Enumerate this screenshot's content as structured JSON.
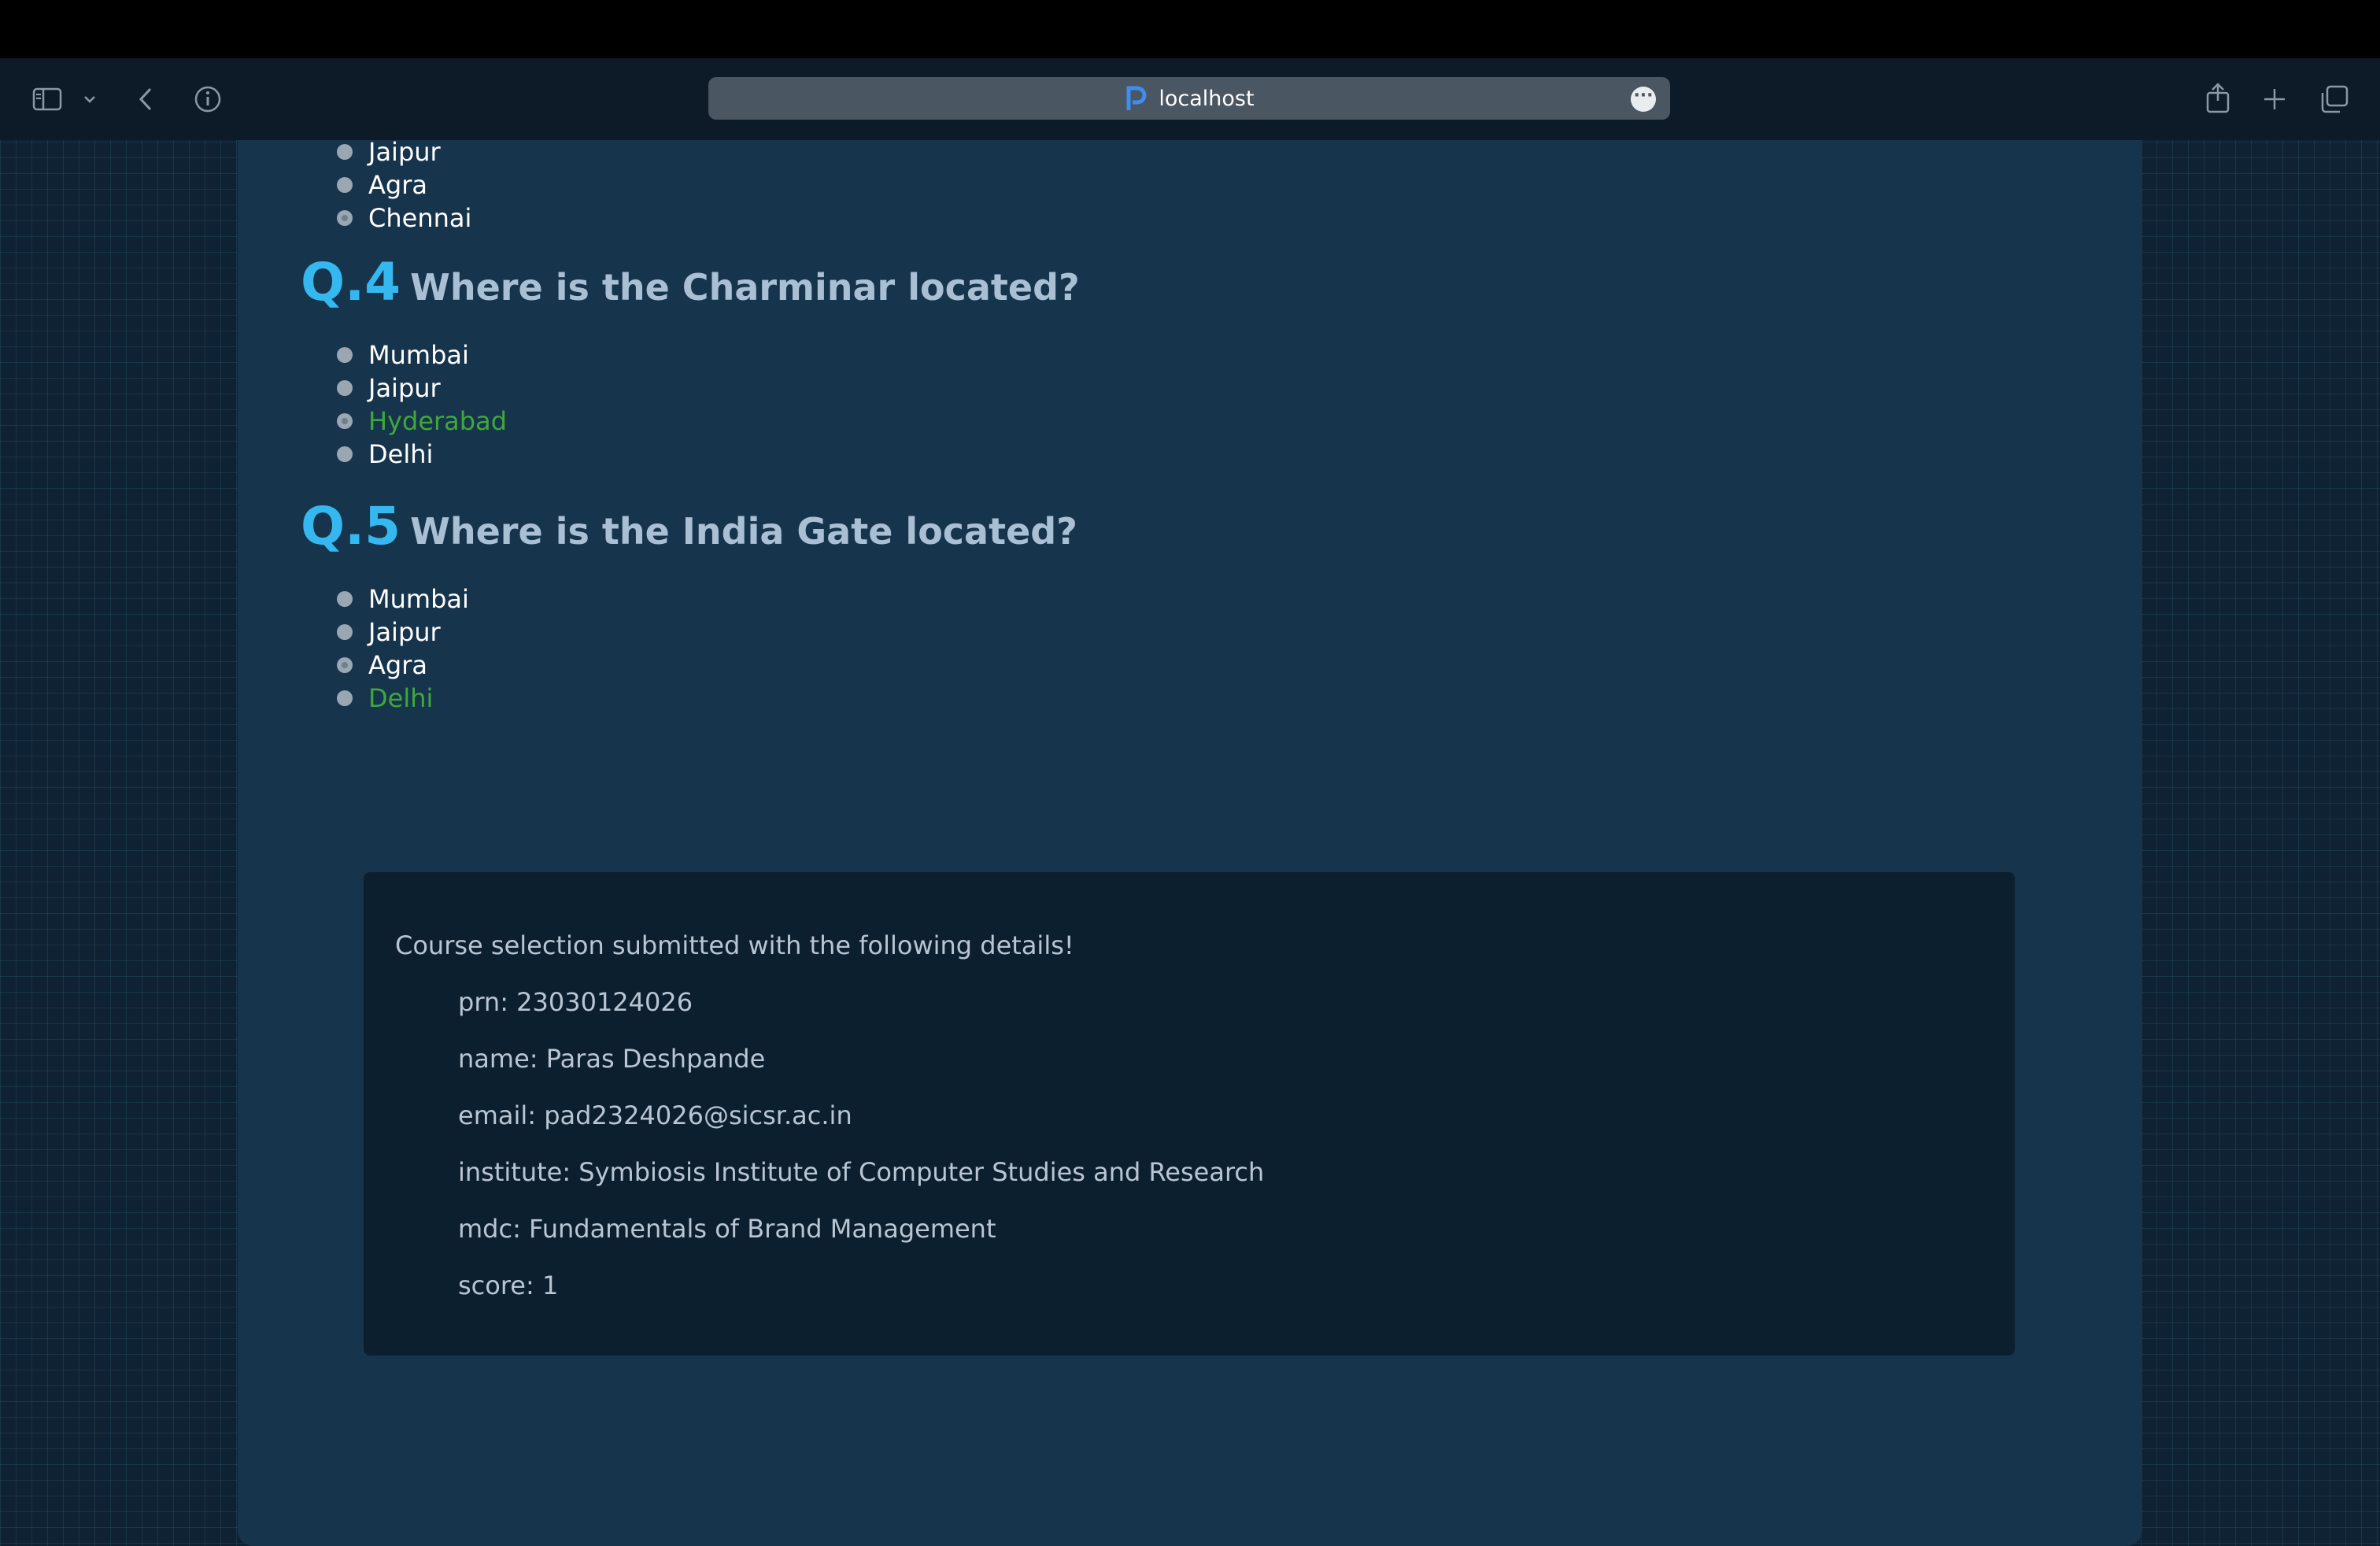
{
  "browser": {
    "url": "localhost"
  },
  "partial_question": {
    "options": [
      {
        "label": "Jaipur",
        "state": "normal"
      },
      {
        "label": "Agra",
        "state": "normal"
      },
      {
        "label": "Chennai",
        "state": "marked"
      }
    ]
  },
  "questions": [
    {
      "number": "Q.4",
      "text": "Where is the Charminar located?",
      "options": [
        {
          "label": "Mumbai",
          "state": "normal"
        },
        {
          "label": "Jaipur",
          "state": "normal"
        },
        {
          "label": "Hyderabad",
          "state": "correct"
        },
        {
          "label": "Delhi",
          "state": "normal"
        }
      ]
    },
    {
      "number": "Q.5",
      "text": "Where is the India Gate located?",
      "options": [
        {
          "label": "Mumbai",
          "state": "normal"
        },
        {
          "label": "Jaipur",
          "state": "normal"
        },
        {
          "label": "Agra",
          "state": "marked"
        },
        {
          "label": "Delhi",
          "state": "correct"
        }
      ]
    }
  ],
  "result": {
    "heading": "Course selection submitted with the following details!",
    "prn": "prn: 23030124026",
    "name": "name: Paras Deshpande",
    "email": "email: pad2324026@sicsr.ac.in",
    "institute": "institute: Symbiosis Institute of Computer Studies and Research",
    "mdc": "mdc: Fundamentals of Brand Management",
    "score": "score: 1"
  },
  "colors": {
    "correct": "#3fa83a",
    "question_number": "#35b8f0",
    "panel": "#17344d"
  }
}
